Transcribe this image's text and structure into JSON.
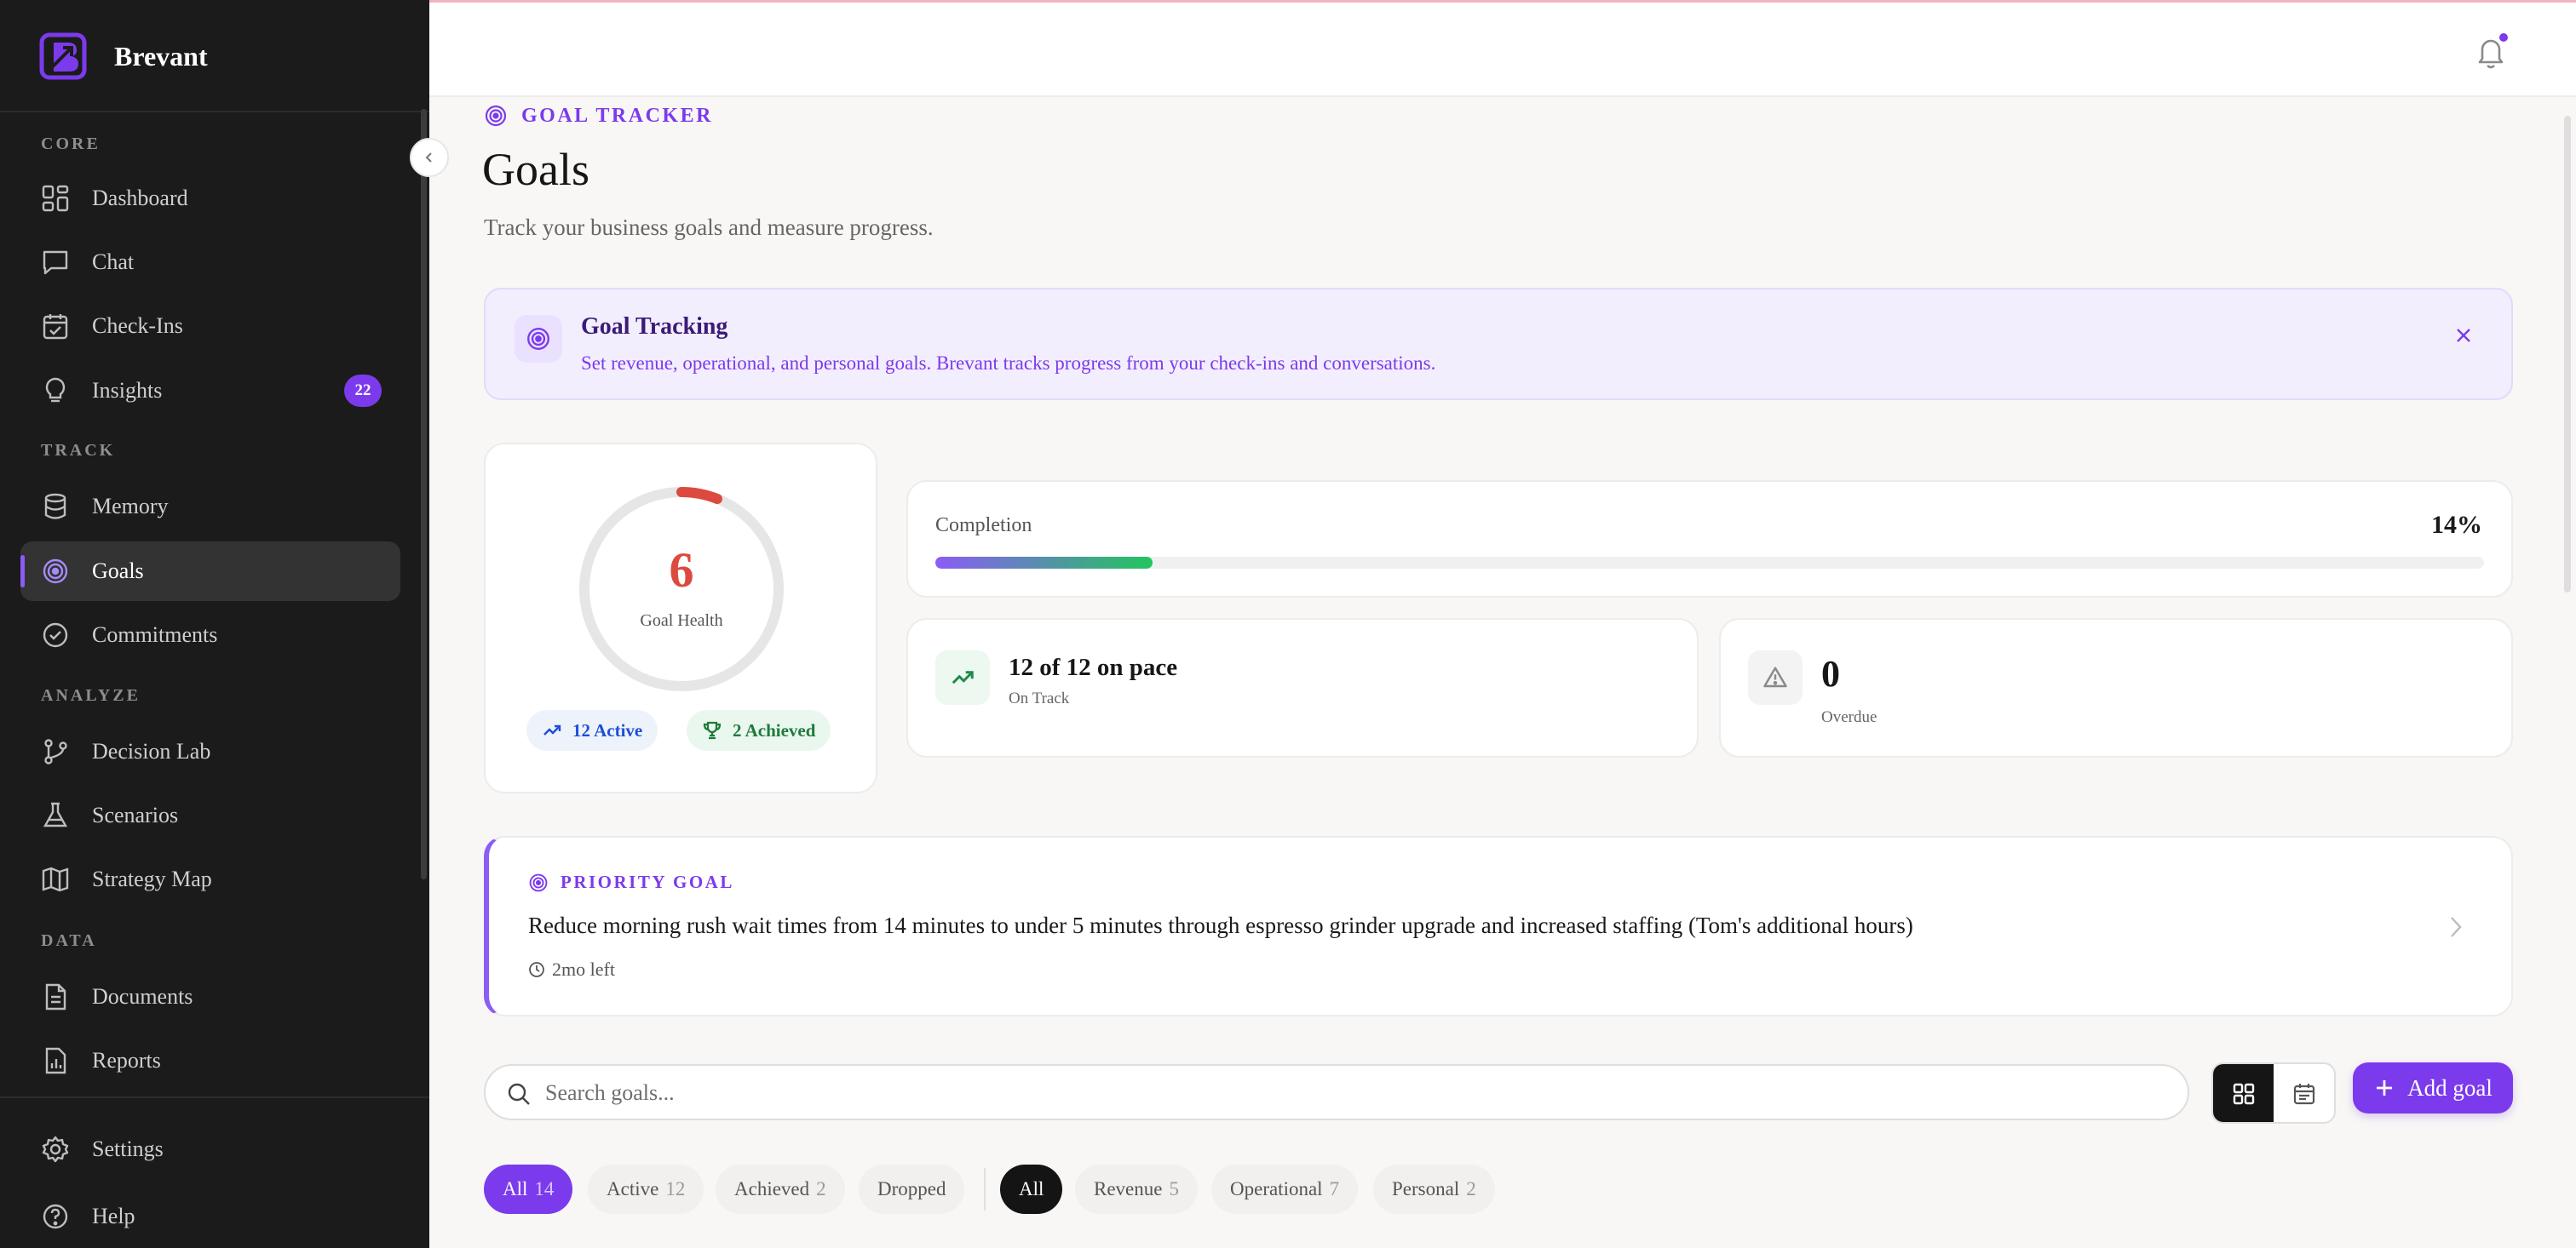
{
  "app": {
    "brand_name": "Brevant",
    "accent_color": "#7c3aed"
  },
  "sidebar": {
    "sections": [
      {
        "label": "CORE"
      },
      {
        "label": "TRACK"
      },
      {
        "label": "ANALYZE"
      },
      {
        "label": "DATA"
      }
    ],
    "items": [
      {
        "label": "Dashboard",
        "icon": "dashboard-icon"
      },
      {
        "label": "Chat",
        "icon": "chat-icon"
      },
      {
        "label": "Check-Ins",
        "icon": "calendar-check-icon"
      },
      {
        "label": "Insights",
        "icon": "lightbulb-icon",
        "badge": "22"
      },
      {
        "label": "Memory",
        "icon": "database-icon"
      },
      {
        "label": "Goals",
        "icon": "target-icon",
        "active": true
      },
      {
        "label": "Commitments",
        "icon": "check-circle-icon"
      },
      {
        "label": "Decision Lab",
        "icon": "git-branch-icon"
      },
      {
        "label": "Scenarios",
        "icon": "flask-icon"
      },
      {
        "label": "Strategy Map",
        "icon": "map-icon"
      },
      {
        "label": "Documents",
        "icon": "document-icon"
      },
      {
        "label": "Reports",
        "icon": "report-icon"
      },
      {
        "label": "Settings",
        "icon": "gear-icon"
      },
      {
        "label": "Help",
        "icon": "help-icon"
      }
    ]
  },
  "header": {
    "eyebrow": "GOAL TRACKER",
    "title": "Goals",
    "subtitle": "Track your business goals and measure progress."
  },
  "banner": {
    "title": "Goal Tracking",
    "text": "Set revenue, operational, and personal goals. Brevant tracks progress from your check-ins and conversations."
  },
  "health": {
    "value": "6",
    "label": "Goal Health",
    "ring_fraction": 0.06,
    "ring_color": "#dc4a3f",
    "active_label": "12 Active",
    "achieved_label": "2 Achieved"
  },
  "completion": {
    "label": "Completion",
    "value_text": "14%",
    "fraction": 0.14
  },
  "on_track": {
    "main": "12 of 12 on pace",
    "sub": "On Track"
  },
  "overdue": {
    "main": "0",
    "sub": "Overdue"
  },
  "priority_goal": {
    "eyebrow": "PRIORITY GOAL",
    "text": "Reduce morning rush wait times from 14 minutes to under 5 minutes through espresso grinder upgrade and increased staffing (Tom's additional hours)",
    "time_left": "2mo left"
  },
  "search": {
    "placeholder": "Search goals...",
    "value": ""
  },
  "add_button": {
    "label": "Add goal"
  },
  "status_filters": [
    {
      "label": "All",
      "count": "14",
      "selected": true
    },
    {
      "label": "Active",
      "count": "12"
    },
    {
      "label": "Achieved",
      "count": "2"
    },
    {
      "label": "Dropped",
      "count": ""
    }
  ],
  "category_filters": [
    {
      "label": "All",
      "count": "",
      "selected": true
    },
    {
      "label": "Revenue",
      "count": "5"
    },
    {
      "label": "Operational",
      "count": "7"
    },
    {
      "label": "Personal",
      "count": "2"
    }
  ]
}
